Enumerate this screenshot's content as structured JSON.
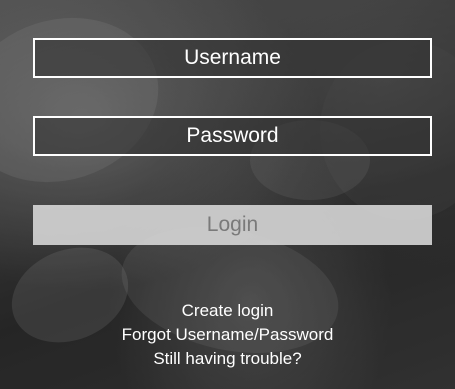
{
  "form": {
    "username_placeholder": "Username",
    "password_placeholder": "Password",
    "login_label": "Login"
  },
  "links": {
    "create": "Create login",
    "forgot": "Forgot Username/Password",
    "trouble": "Still having trouble?"
  }
}
